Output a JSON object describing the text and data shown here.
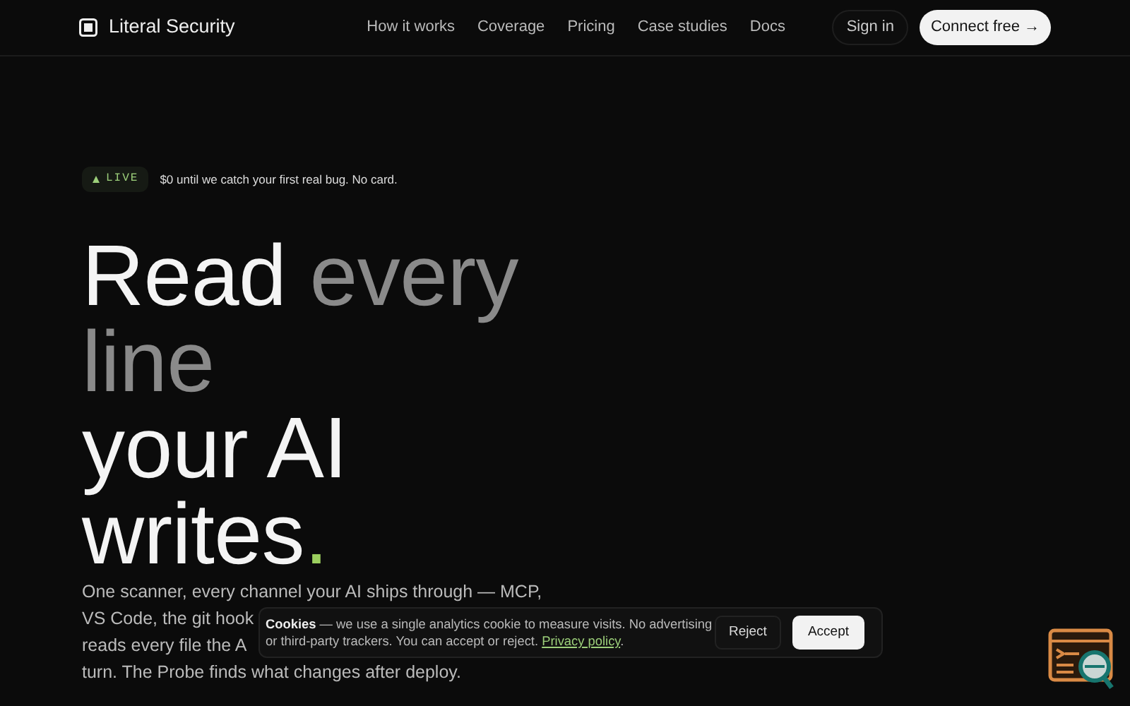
{
  "brand": {
    "name": "Literal Security"
  },
  "nav": {
    "links": [
      "How it works",
      "Coverage",
      "Pricing",
      "Case studies",
      "Docs"
    ],
    "sign_in": "Sign in",
    "cta": "Connect free →"
  },
  "badge": {
    "tag": "LIVE",
    "text": "$0 until we catch your first real bug. No card."
  },
  "headline": [
    [
      {
        "text": "Read ",
        "color": "#f4f4f4"
      },
      {
        "text": "every",
        "color": "#8a8a8a"
      }
    ],
    [
      {
        "text": "line",
        "color": "#8a8a8a"
      }
    ],
    [
      {
        "text": "your AI",
        "color": "#f4f4f4"
      }
    ],
    [
      {
        "text": "writes",
        "color": "#f4f4f4"
      },
      {
        "text": ".",
        "color": "#9ccf5f"
      }
    ]
  ],
  "intro_lines": [
    "One scanner, every channel your AI ships through — MCP,",
    "VS Code, the git hook",
    "reads every file the A",
    "turn. The Probe finds what changes after deploy."
  ],
  "cookie_banner": {
    "text": "**Cookies** — we use a single analytics cookie to measure visits. No advertising or third-party trackers. You can accept or reject.",
    "link": "Privacy policy",
    "after_link": ".",
    "reject": "Reject",
    "accept": "Accept"
  }
}
